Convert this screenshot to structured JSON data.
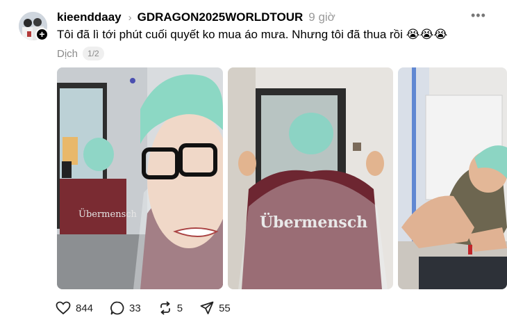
{
  "post": {
    "username": "kieenddaay",
    "community": "GDRAGON2025WORLDTOUR",
    "time": "9 giờ",
    "text": "Tôi đã lì tới phút cuối quyết ko mua áo mưa. Nhưng tôi đã thua rồi 😭😭😭",
    "translate_label": "Dịch",
    "page_indicator": "1/2",
    "shirt_print": "Übermensch"
  },
  "actions": {
    "likes": "844",
    "comments": "33",
    "reposts": "5",
    "shares": "55"
  },
  "icons": [
    "chevron-right-icon",
    "more-icon",
    "plus-icon",
    "heart-icon",
    "comment-icon",
    "repost-icon",
    "share-icon"
  ]
}
